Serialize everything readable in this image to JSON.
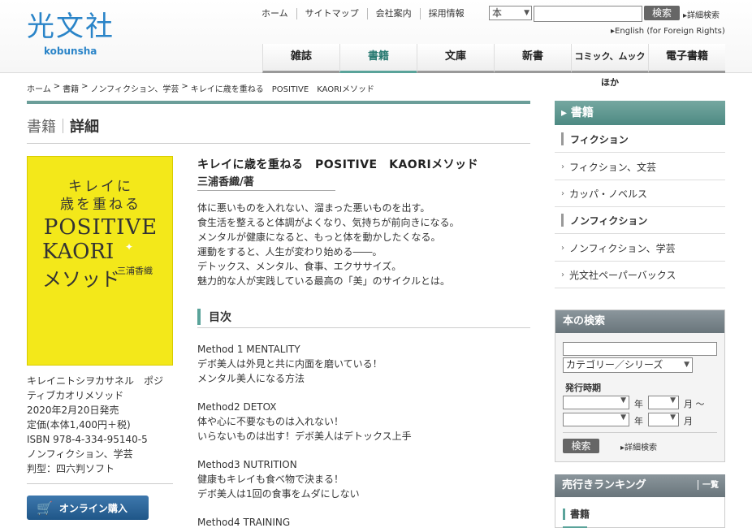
{
  "header": {
    "logo": "光文社",
    "logo_sub": "kobunsha",
    "util_nav": [
      "ホーム",
      "サイトマップ",
      "会社案内",
      "採用情報"
    ],
    "search_select": "本",
    "search_button": "検索",
    "advanced_search": "詳細検索",
    "english_link": "English (for Foreign Rights)",
    "main_nav": [
      {
        "label": "雑誌"
      },
      {
        "label": "書籍",
        "active": true
      },
      {
        "label": "文庫"
      },
      {
        "label": "新書"
      },
      {
        "label": "コミック、ムックほか"
      },
      {
        "label": "電子書籍"
      }
    ]
  },
  "breadcrumb": [
    "ホーム",
    "書籍",
    "ノンフィクション、学芸",
    "キレイに歳を重ねる　POSITIVE　KAORIメソッド"
  ],
  "page_title": {
    "section": "書籍",
    "sub": "詳細"
  },
  "book": {
    "cover": {
      "line1": "キレイに",
      "line2": "歳を重ねる",
      "line3": "POSITIVE",
      "line4": "KAORI",
      "line5": "メソッド",
      "author": "三浦香織"
    },
    "title": "キレイに歳を重ねる　POSITIVE　KAORIメソッド",
    "author": "三浦香織/著",
    "meta": [
      "キレイニトシヲカサネル　ポジティブカオリメソッド",
      "2020年2月20日発売",
      "定価(本体1,400円＋税)",
      "ISBN 978-4-334-95140-5",
      "ノンフィクション、学芸",
      "判型：四六判ソフト"
    ],
    "buy_button": "オンライン購入",
    "description": [
      "体に悪いものを入れない、溜まった悪いものを出す。",
      "食生活を整えると体調がよくなり、気持ちが前向きになる。",
      "メンタルが健康になると、もっと体を動かしたくなる。",
      "運動をすると、人生が変わり始める――。",
      "デトックス、メンタル、食事、エクササイズ。",
      "魅力的な人が実践している最高の「美」のサイクルとは。"
    ],
    "toc_heading": "目次",
    "toc": [
      {
        "title": "Method 1  MENTALITY",
        "lines": [
          "デボ美人は外見と共に内面を磨いている！",
          "メンタル美人になる方法"
        ]
      },
      {
        "title": "Method2  DETOX",
        "lines": [
          "体や心に不要なものは入れない！",
          "いらないものは出す！デボ美人はデトックス上手"
        ]
      },
      {
        "title": "Method3  NUTRITION",
        "lines": [
          "健康もキレイも食べ物で決まる！",
          "デボ美人は1回の食事をムダにしない"
        ]
      },
      {
        "title": "Method4  TRAINING",
        "lines": []
      }
    ]
  },
  "sidebar": {
    "heading": "書籍",
    "categories": [
      {
        "label": "フィクション",
        "type": "strong"
      },
      {
        "label": "フィクション、文芸",
        "type": "sub"
      },
      {
        "label": "カッパ・ノベルス",
        "type": "sub"
      },
      {
        "label": "ノンフィクション",
        "type": "strong"
      },
      {
        "label": "ノンフィクション、学芸",
        "type": "sub"
      },
      {
        "label": "光文社ペーパーバックス",
        "type": "sub"
      }
    ],
    "search": {
      "heading": "本の検索",
      "category_select": "カテゴリー／シリーズ",
      "period_label": "発行時期",
      "year": "年",
      "month": "月",
      "tilde": "月 ～",
      "button": "検索",
      "advanced": "詳細検索"
    },
    "ranking": {
      "heading": "売行きランキング",
      "all": "一覧",
      "sub": "書籍"
    }
  }
}
